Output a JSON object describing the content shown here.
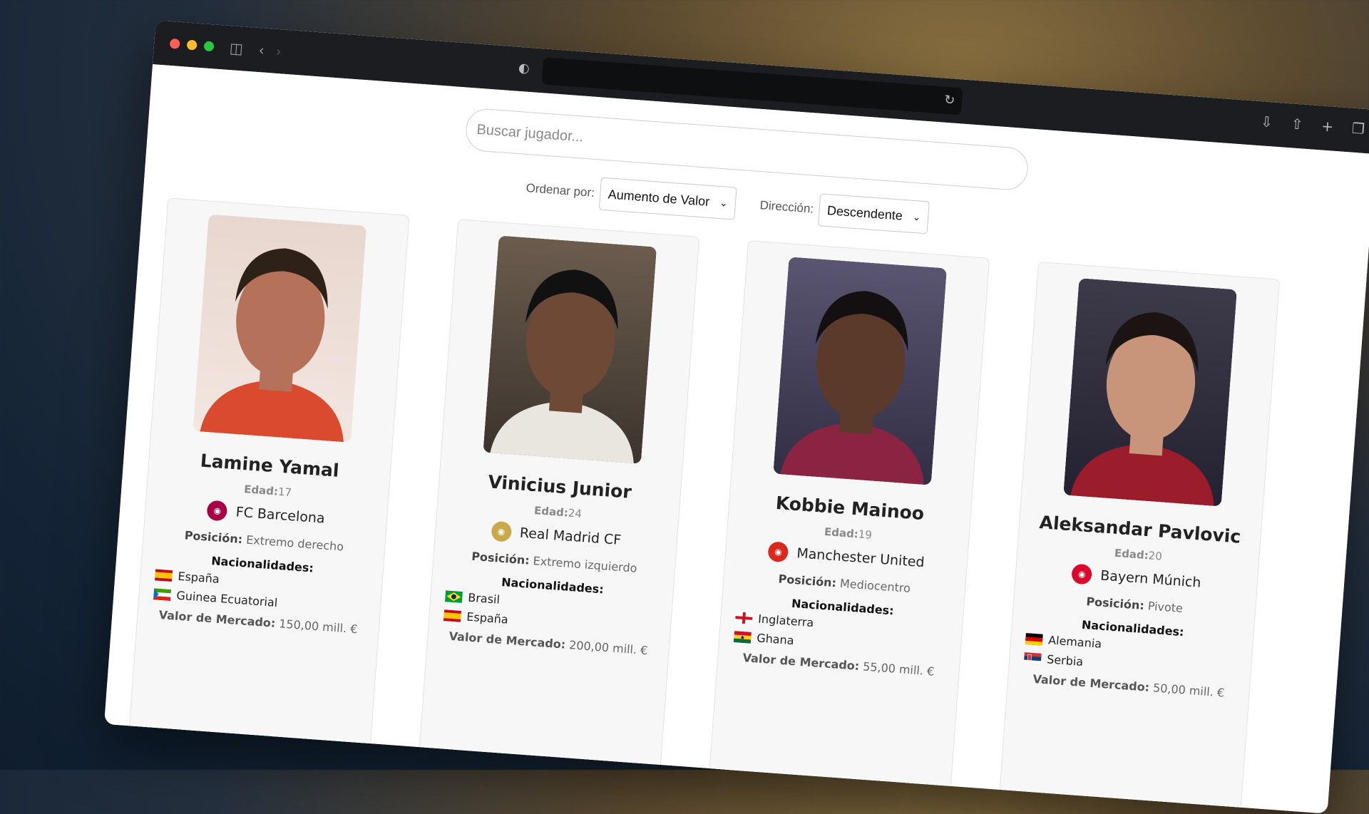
{
  "browser": {
    "icons": {
      "sidebar": "sidebar-icon",
      "back": "chevron-left-icon",
      "forward": "chevron-right-icon",
      "shield": "shield-icon",
      "reload": "reload-icon",
      "download": "download-icon",
      "share": "share-icon",
      "new_tab": "plus-icon",
      "tabs": "tabs-overview-icon"
    }
  },
  "search": {
    "placeholder": "Buscar jugador..."
  },
  "sort": {
    "label": "Ordenar por:",
    "selected": "Aumento de Valor",
    "direction_label": "Dirección:",
    "direction_selected": "Descendente"
  },
  "labels": {
    "age": "Edad:",
    "position": "Posición:",
    "nationalities": "Nacionalidades:",
    "market_value": "Valor de Mercado:"
  },
  "players": [
    {
      "name": "Lamine Yamal",
      "age": "17",
      "club": "FC Barcelona",
      "club_color": "#a50044",
      "position": "Extremo derecho",
      "nationalities": [
        "España",
        "Guinea Ecuatorial"
      ],
      "market_value": "150,00 mill. €"
    },
    {
      "name": "Vinicius Junior",
      "age": "24",
      "club": "Real Madrid CF",
      "club_color": "#c9a94a",
      "position": "Extremo izquierdo",
      "nationalities": [
        "Brasil",
        "España"
      ],
      "market_value": "200,00 mill. €"
    },
    {
      "name": "Kobbie Mainoo",
      "age": "19",
      "club": "Manchester United",
      "club_color": "#da291c",
      "position": "Mediocentro",
      "nationalities": [
        "Inglaterra",
        "Ghana"
      ],
      "market_value": "55,00 mill. €"
    },
    {
      "name": "Aleksandar Pavlovic",
      "age": "20",
      "club": "Bayern Múnich",
      "club_color": "#dc052d",
      "position": "Pivote",
      "nationalities": [
        "Alemania",
        "Serbia"
      ],
      "market_value": "50,00 mill. €"
    }
  ]
}
